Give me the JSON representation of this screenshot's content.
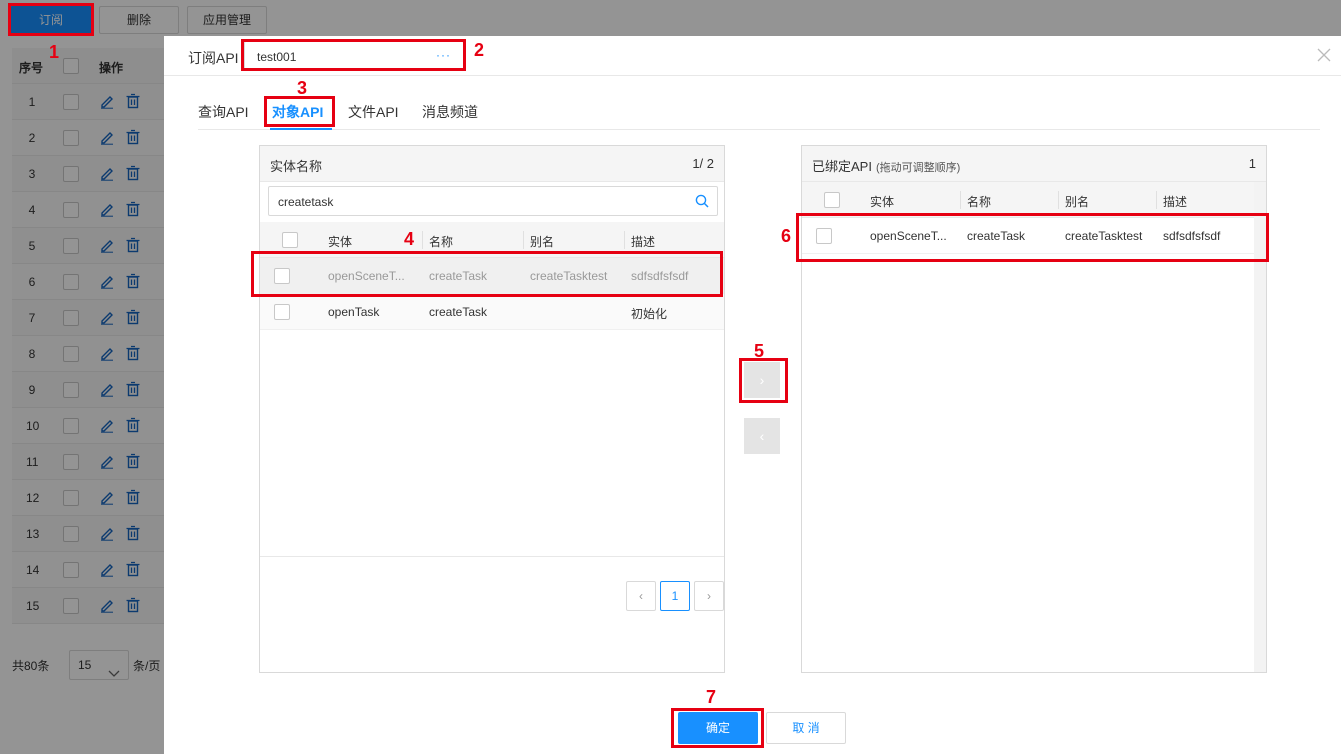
{
  "toolbar": {
    "subscribe_label": "订阅",
    "delete_label": "删除",
    "app_manage_label": "应用管理"
  },
  "bg_table": {
    "col_index": "序号",
    "col_action": "操作",
    "rows": [
      "1",
      "2",
      "3",
      "4",
      "5",
      "6",
      "7",
      "8",
      "9",
      "10",
      "11",
      "12",
      "13",
      "14",
      "15"
    ],
    "total": "共80条",
    "page_size": "15",
    "page_size_unit": "条/页"
  },
  "modal": {
    "title": "订阅API",
    "api_value": "test001",
    "api_more": "···",
    "tabs": [
      "查询API",
      "对象API",
      "文件API",
      "消息频道"
    ],
    "active_tab": "对象API",
    "left_panel": {
      "title": "实体名称",
      "count": "1/ 2",
      "search_value": "createtask",
      "columns": [
        "实体",
        "名称",
        "别名",
        "描述"
      ],
      "rows": [
        {
          "entity": "openSceneT...",
          "name": "createTask",
          "alias": "createTasktest",
          "desc": "sdfsdfsfsdf"
        },
        {
          "entity": "openTask",
          "name": "createTask",
          "alias": "",
          "desc": "初始化"
        }
      ],
      "current_page": "1",
      "prev": "‹",
      "next": "›"
    },
    "right_panel": {
      "title": "已绑定API",
      "hint": "(拖动可调整顺序)",
      "count": "1",
      "columns": [
        "实体",
        "名称",
        "别名",
        "描述"
      ],
      "rows": [
        {
          "entity": "openSceneT...",
          "name": "createTask",
          "alias": "createTasktest",
          "desc": "sdfsdfsfsdf"
        }
      ]
    },
    "move_right": "›",
    "move_left": "‹",
    "ok_label": "确定",
    "cancel_label": "取 消"
  },
  "annotations": [
    "1",
    "2",
    "3",
    "4",
    "5",
    "6",
    "7"
  ],
  "colors": {
    "primary": "#1890ff",
    "annotation": "#e60012"
  }
}
